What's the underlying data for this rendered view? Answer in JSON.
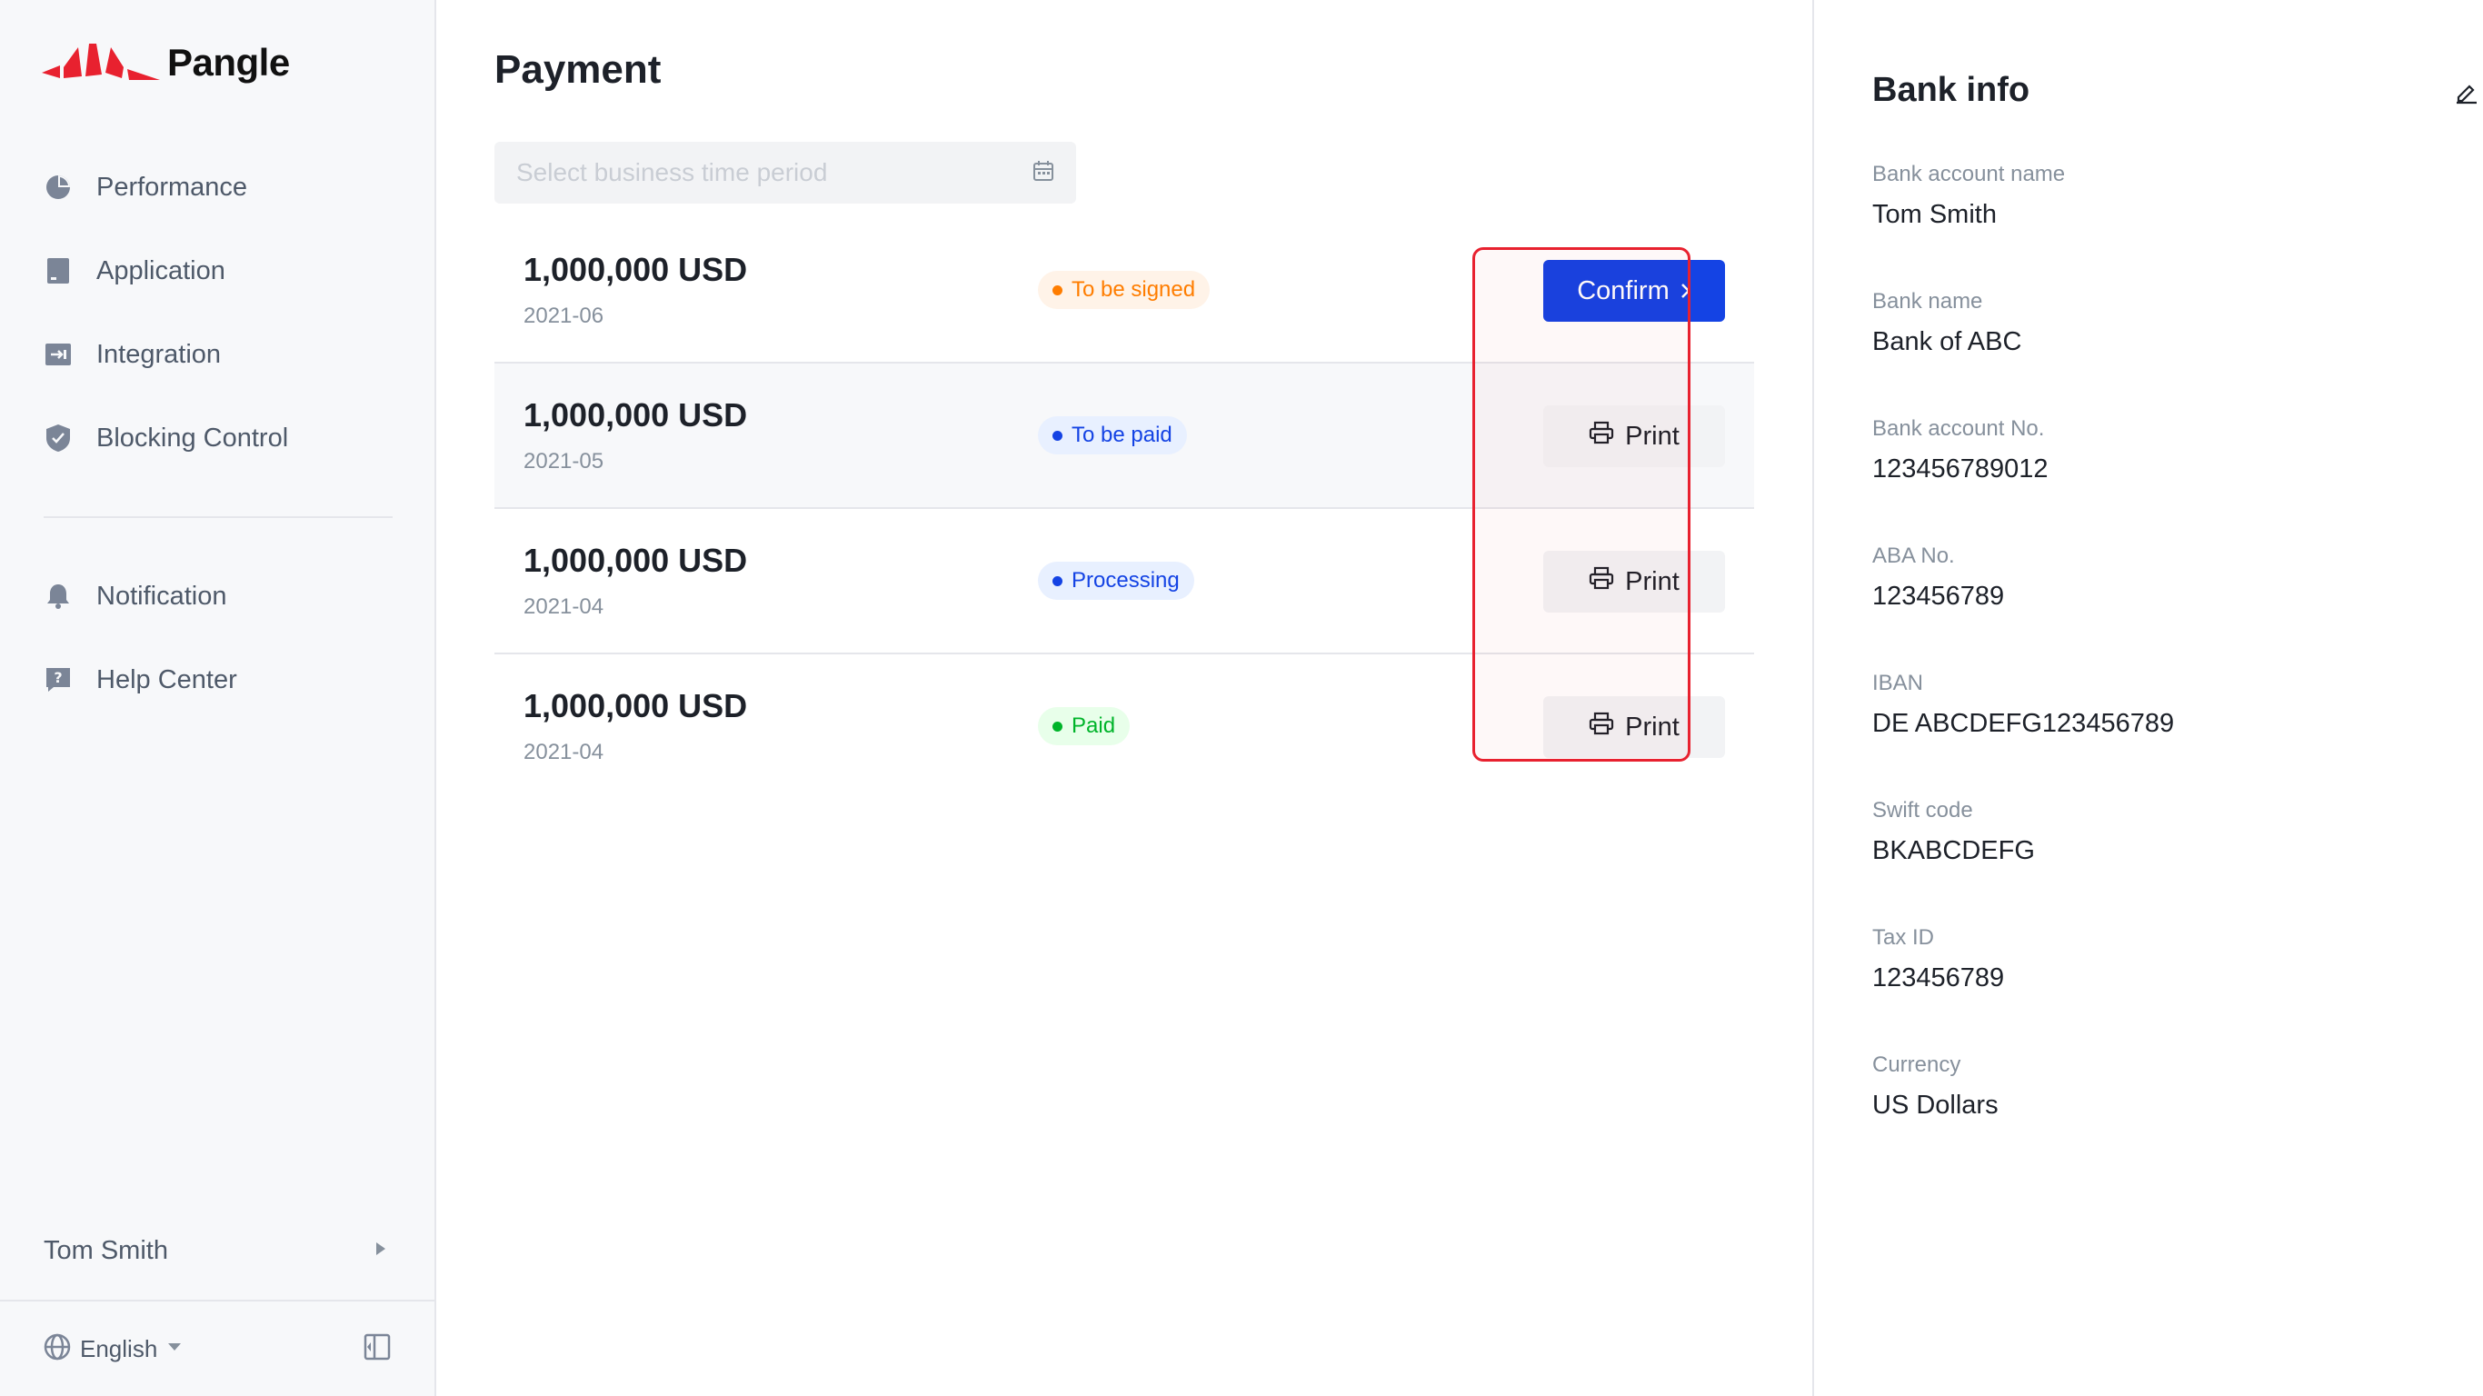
{
  "app": {
    "logo_text": "Pangle",
    "brand_color": "#e8212f"
  },
  "sidebar": {
    "items": [
      {
        "label": "Performance",
        "icon": "pie-chart-icon"
      },
      {
        "label": "Application",
        "icon": "application-icon"
      },
      {
        "label": "Integration",
        "icon": "integration-icon"
      },
      {
        "label": "Blocking Control",
        "icon": "shield-icon"
      }
    ],
    "secondary_items": [
      {
        "label": "Notification",
        "icon": "bell-icon"
      },
      {
        "label": "Help Center",
        "icon": "help-icon"
      }
    ],
    "user_name": "Tom Smith",
    "language": "English"
  },
  "main": {
    "title": "Payment",
    "date_picker_placeholder": "Select business time period",
    "payments": [
      {
        "amount": "1,000,000 USD",
        "period": "2021-06",
        "status": "To be signed",
        "status_color": "#ff7d00",
        "status_bg": "#fff3e8",
        "action": "Confirm",
        "action_type": "primary"
      },
      {
        "amount": "1,000,000 USD",
        "period": "2021-05",
        "status": "To be paid",
        "status_color": "#1443e4",
        "status_bg": "#e8f0ff",
        "action": "Print",
        "action_type": "secondary"
      },
      {
        "amount": "1,000,000 USD",
        "period": "2021-04",
        "status": "Processing",
        "status_color": "#1443e4",
        "status_bg": "#e8f0ff",
        "action": "Print",
        "action_type": "secondary"
      },
      {
        "amount": "1,000,000 USD",
        "period": "2021-04",
        "status": "Paid",
        "status_color": "#00b42a",
        "status_bg": "#e8ffea",
        "action": "Print",
        "action_type": "secondary"
      }
    ]
  },
  "bank_info": {
    "title": "Bank info",
    "fields": [
      {
        "label": "Bank account name",
        "value": "Tom Smith"
      },
      {
        "label": "Bank name",
        "value": "Bank of ABC"
      },
      {
        "label": "Bank account No.",
        "value": "123456789012"
      },
      {
        "label": "ABA No.",
        "value": "123456789"
      },
      {
        "label": "IBAN",
        "value": "DE ABCDEFG123456789"
      },
      {
        "label": "Swift code",
        "value": "BKABCDEFG"
      },
      {
        "label": "Tax ID",
        "value": "123456789"
      },
      {
        "label": "Currency",
        "value": "US Dollars"
      }
    ]
  }
}
